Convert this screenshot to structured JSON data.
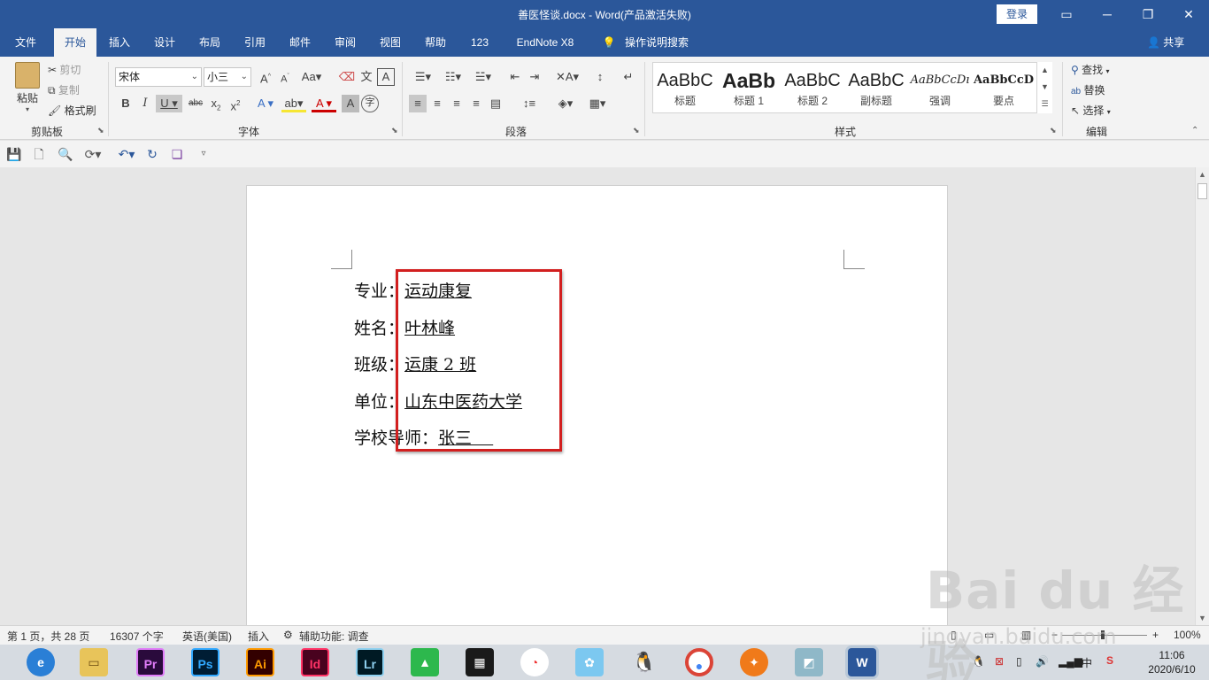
{
  "window": {
    "title": "善医怪谈.docx  -  Word(产品激活失败)",
    "login_label": "登录",
    "controls": [
      "▭",
      "🗗",
      "─",
      "✕"
    ]
  },
  "tabs": [
    {
      "label": "文件",
      "active": false
    },
    {
      "label": "开始",
      "active": true
    },
    {
      "label": "插入",
      "active": false
    },
    {
      "label": "设计",
      "active": false
    },
    {
      "label": "布局",
      "active": false
    },
    {
      "label": "引用",
      "active": false
    },
    {
      "label": "邮件",
      "active": false
    },
    {
      "label": "审阅",
      "active": false
    },
    {
      "label": "视图",
      "active": false
    },
    {
      "label": "帮助",
      "active": false
    },
    {
      "label": "123",
      "active": false
    },
    {
      "label": "EndNote X8",
      "active": false
    },
    {
      "label": "操作说明搜索",
      "active": false
    }
  ],
  "share_label": "共享",
  "clipboard": {
    "group_label": "剪贴板",
    "paste_label": "粘贴",
    "cut_label": "剪切",
    "copy_label": "复制",
    "format_painter_label": "格式刷"
  },
  "font": {
    "group_label": "字体",
    "font_name": "宋体",
    "font_size": "小三",
    "case_label": "Aa",
    "strike_label": "abc"
  },
  "paragraph": {
    "group_label": "段落"
  },
  "styles": {
    "group_label": "样式",
    "items": [
      {
        "preview": "AaBbC",
        "label": "标题"
      },
      {
        "preview": "AaBb",
        "label": "标题 1"
      },
      {
        "preview": "AaBbC",
        "label": "标题 2"
      },
      {
        "preview": "AaBbC",
        "label": "副标题"
      },
      {
        "preview": "AaBbCcDı",
        "label": "强调"
      },
      {
        "preview": "AaBbCcD",
        "label": "要点"
      }
    ]
  },
  "editing": {
    "group_label": "编辑",
    "find_label": "查找",
    "replace_label": "替换",
    "select_label": "选择"
  },
  "document": {
    "lines": [
      {
        "label": "专业：",
        "value": "运动康复"
      },
      {
        "label": "姓名：",
        "value": "叶林峰"
      },
      {
        "label": "班级：",
        "value": "运康 2 班"
      },
      {
        "label": "单位：",
        "value": "山东中医药大学"
      },
      {
        "label": "学校导师：",
        "value": "张三    "
      }
    ]
  },
  "status": {
    "page": "第 1 页，共 28 页",
    "words": "16307 个字",
    "language": "英语(美国)",
    "mode": "插入",
    "accessibility": "辅助功能: 调查",
    "zoom": "100%"
  },
  "taskbar": {
    "apps": [
      "Pr",
      "Ps",
      "Ai",
      "Id",
      "Lr"
    ],
    "ime": "中",
    "time": "11:06",
    "date": "2020/6/10"
  },
  "watermark": {
    "brand": "Bai du 经验",
    "url": "jingyan.baidu.com"
  },
  "colors": {
    "brand_blue": "#2b579a",
    "highlight_red": "#d21f1f"
  }
}
